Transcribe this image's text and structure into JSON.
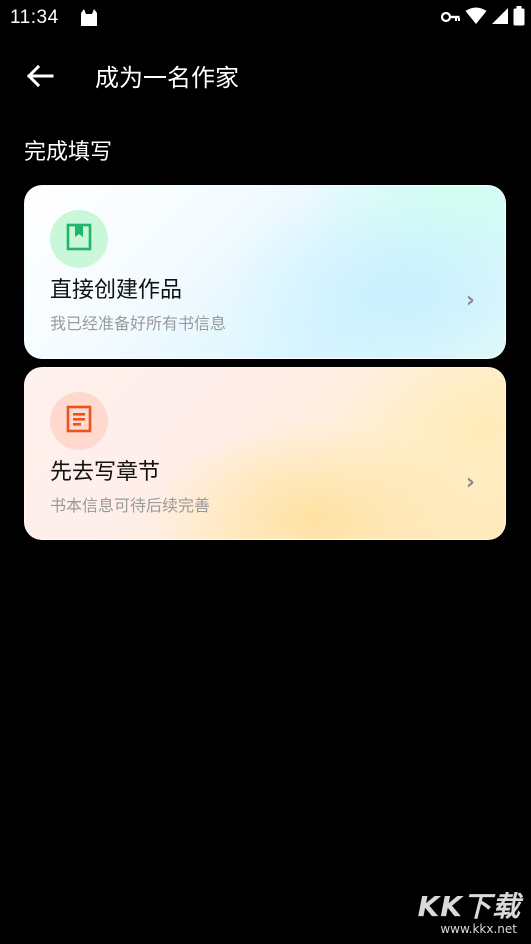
{
  "status_bar": {
    "time": "11:34",
    "icons": [
      "cat-icon",
      "key-icon",
      "wifi-icon",
      "signal-icon",
      "battery-icon"
    ]
  },
  "app_bar": {
    "title": "成为一名作家",
    "back_icon": "arrow-left-icon"
  },
  "section": {
    "label": "完成填写"
  },
  "options": [
    {
      "title": "直接创建作品",
      "subtitle": "我已经准备好所有书信息",
      "icon": "bookmark-book-icon",
      "accent_color": "#1fb56a",
      "chevron": "›"
    },
    {
      "title": "先去写章节",
      "subtitle": "书本信息可待后续完善",
      "icon": "document-icon",
      "accent_color": "#e8541c",
      "chevron": "›"
    }
  ],
  "watermark": {
    "logo": "KK下载",
    "url": "www.kkx.net"
  }
}
